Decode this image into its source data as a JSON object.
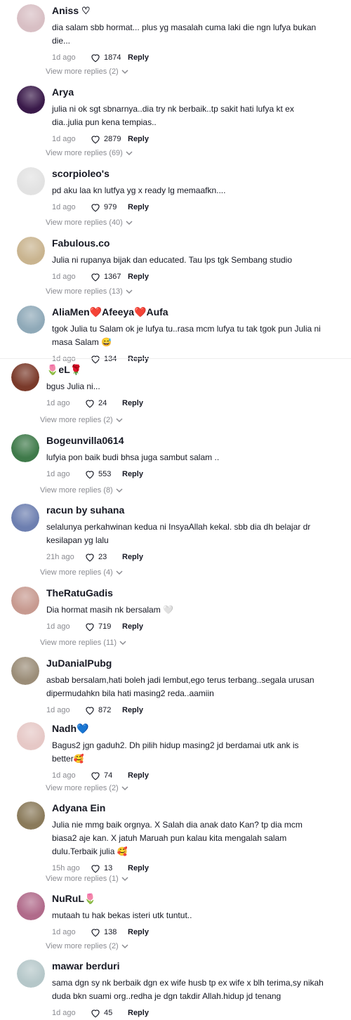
{
  "reply_label": "Reply",
  "comments": [
    {
      "user": "Aniss ♡",
      "text": "dia salam sbb hormat... plus yg masalah cuma laki die ngn lufya bukan die...",
      "date": "1d ago",
      "likes": "1874",
      "more": "View more replies (2)",
      "avatar_color": "#d8bfc4"
    },
    {
      "user": "Arya",
      "text": "julia ni ok sgt sbnarnya..dia try nk berbaik..tp sakit hati lufya kt ex dia..julia pun kena tempias..",
      "date": "1d ago",
      "likes": "2879",
      "more": "View more replies (69)",
      "avatar_color": "#3a1a4a"
    },
    {
      "user": "scorpioleo's",
      "text": "pd aku laa kn lutfya yg x ready lg memaafkn....",
      "date": "1d ago",
      "likes": "979",
      "more": "View more replies (40)",
      "avatar_color": "#e2e2e2"
    },
    {
      "user": "Fabulous.co",
      "text": "Julia ni rupanya bijak dan educated. Tau lps tgk Sembang studio",
      "date": "1d ago",
      "likes": "1367",
      "more": "View more replies (13)",
      "avatar_color": "#c9b48f"
    },
    {
      "user": "AliaMen❤️Afeeya❤️Aufa",
      "text": "tgok Julia tu Salam ok je lufya tu..rasa mcm lufya tu tak tgok pun Julia ni masa Salam 😅",
      "date": "1d ago",
      "likes": "134",
      "more": "",
      "avatar_color": "#8fa9b8"
    },
    {
      "user": "🌷eL🌹",
      "text": "bgus Julia ni...",
      "date": "1d ago",
      "likes": "24",
      "more": "View more replies (2)",
      "avatar_color": "#7a3a2a"
    },
    {
      "user": "Bogeunvilla0614",
      "text": "lufyia pon baik budi bhsa juga sambut salam ..",
      "date": "1d ago",
      "likes": "553",
      "more": "View more replies (8)",
      "avatar_color": "#3f7a4a"
    },
    {
      "user": "racun by suhana",
      "text": "selalunya perkahwinan kedua ni InsyaAllah kekal. sbb dia dh belajar dr kesilapan yg lalu",
      "date": "21h ago",
      "likes": "23",
      "more": "View more replies (4)",
      "avatar_color": "#6d7fb0"
    },
    {
      "user": "TheRatuGadis",
      "text": "Dia hormat masih nk bersalam 🤍",
      "date": "1d ago",
      "likes": "719",
      "more": "View more replies (11)",
      "avatar_color": "#c79a90"
    },
    {
      "user": "JuDanialPubg",
      "text": "asbab bersalam,hati boleh jadi lembut,ego terus terbang..segala urusan dipermudahkn bila hati masing2 reda..aamiin",
      "date": "1d ago",
      "likes": "872",
      "more": "",
      "avatar_color": "#9b8d78"
    },
    {
      "user": "Nadh💙",
      "text": "Bagus2 jgn gaduh2. Dh pilih hidup masing2 jd berdamai utk ank is better🥰",
      "date": "1d ago",
      "likes": "74",
      "more": "View more replies (2)",
      "avatar_color": "#e6c8c6"
    },
    {
      "user": "Adyana Ein",
      "text": "Julia nie mmg baik orgnya. X Salah dia anak dato Kan? tp dia mcm biasa2 aje kan. X jatuh Maruah pun kalau kita mengalah salam dulu.Terbaik julia 🥰",
      "date": "15h ago",
      "likes": "13",
      "more": "View more replies (1)",
      "avatar_color": "#8a7a5a"
    },
    {
      "user": "NuRuL🌷",
      "text": "mutaah tu hak bekas isteri utk tuntut..",
      "date": "1d ago",
      "likes": "138",
      "more": "View more replies (2)",
      "avatar_color": "#b06a8a"
    },
    {
      "user": "mawar berduri",
      "text": "sama dgn sy nk berbaik dgn ex wife husb tp ex wife x blh terima,sy nikah duda bkn suami org..redha je dgn takdir Allah.hidup jd tenang",
      "date": "1d ago",
      "likes": "45",
      "more": "",
      "avatar_color": "#b5c7c9"
    }
  ]
}
